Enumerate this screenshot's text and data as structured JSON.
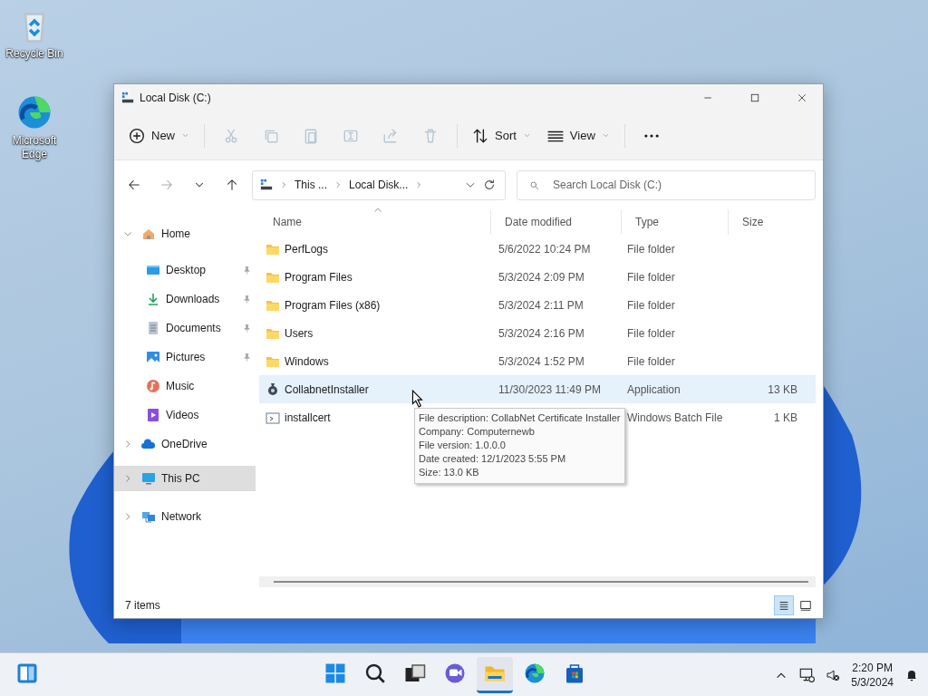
{
  "desktop_icons": [
    {
      "kind": "recycle",
      "label": "Recycle Bin"
    },
    {
      "kind": "edge",
      "label": "Microsoft Edge"
    }
  ],
  "window": {
    "title": "Local Disk (C:)"
  },
  "toolbar": [
    {
      "kind": "new",
      "label": "New",
      "disabled": false
    },
    {
      "kind": "cut",
      "disabled": true
    },
    {
      "kind": "copy",
      "disabled": true
    },
    {
      "kind": "paste",
      "disabled": true
    },
    {
      "kind": "rename",
      "disabled": true
    },
    {
      "kind": "share",
      "disabled": true
    },
    {
      "kind": "delete",
      "disabled": true
    },
    {
      "kind": "sort",
      "label": "Sort",
      "disabled": false
    },
    {
      "kind": "view",
      "label": "View",
      "disabled": false
    },
    {
      "kind": "more",
      "disabled": false
    }
  ],
  "nav": {
    "forward_disabled": true,
    "breadcrumb": [
      "This ...",
      "Local Disk..."
    ],
    "search": {
      "placeholder": "Search Local Disk (C:)"
    }
  },
  "sidebar": {
    "items": [
      {
        "kind": "home",
        "label": "Home",
        "expanded": true,
        "selected": false,
        "children": [
          {
            "kind": "desktop",
            "label": "Desktop",
            "pinned": true
          },
          {
            "kind": "downloads",
            "label": "Downloads",
            "pinned": true
          },
          {
            "kind": "documents",
            "label": "Documents",
            "pinned": true
          },
          {
            "kind": "pictures",
            "label": "Pictures",
            "pinned": true
          },
          {
            "kind": "music",
            "label": "Music",
            "pinned": false
          },
          {
            "kind": "videos",
            "label": "Videos",
            "pinned": false
          }
        ]
      },
      {
        "kind": "onedrive",
        "label": "OneDrive",
        "expanded": false,
        "selected": false
      },
      {
        "kind": "pc",
        "label": "This PC",
        "expanded": false,
        "selected": true
      },
      {
        "kind": "network",
        "label": "Network",
        "expanded": false,
        "selected": false
      }
    ]
  },
  "table": {
    "columns": [
      "Name",
      "Date modified",
      "Type",
      "Size"
    ],
    "rows": [
      {
        "kind": "folder",
        "name": "PerfLogs",
        "date": "5/6/2022 10:24 PM",
        "type": "File folder",
        "size": "",
        "selected": false
      },
      {
        "kind": "folder",
        "name": "Program Files",
        "date": "5/3/2024 2:09 PM",
        "type": "File folder",
        "size": "",
        "selected": false
      },
      {
        "kind": "folder",
        "name": "Program Files (x86)",
        "date": "5/3/2024 2:11 PM",
        "type": "File folder",
        "size": "",
        "selected": false
      },
      {
        "kind": "folder",
        "name": "Users",
        "date": "5/3/2024 2:16 PM",
        "type": "File folder",
        "size": "",
        "selected": false
      },
      {
        "kind": "folder",
        "name": "Windows",
        "date": "5/3/2024 1:52 PM",
        "type": "File folder",
        "size": "",
        "selected": false
      },
      {
        "kind": "app",
        "name": "CollabnetInstaller",
        "date": "11/30/2023 11:49 PM",
        "type": "Application",
        "size": "13 KB",
        "selected": true
      },
      {
        "kind": "batch",
        "name": "installcert",
        "date": "",
        "type": "Windows Batch File",
        "size": "1 KB",
        "selected": false
      }
    ]
  },
  "tooltip": [
    "File description: CollabNet Certificate Installer",
    "Company: Computernewb",
    "File version: 1.0.0.0",
    "Date created: 12/1/2023 5:55 PM",
    "Size: 13.0 KB"
  ],
  "status_bar": {
    "count": "7 items",
    "views": [
      {
        "kind": "details",
        "selected": true
      },
      {
        "kind": "tiles",
        "selected": false
      }
    ]
  },
  "taskbar": {
    "apps": [
      {
        "kind": "widgets",
        "active": false
      },
      {
        "kind": "start",
        "active": false
      },
      {
        "kind": "search",
        "active": false
      },
      {
        "kind": "taskview",
        "active": false
      },
      {
        "kind": "chat",
        "active": false
      },
      {
        "kind": "explorer",
        "active": true
      },
      {
        "kind": "edge",
        "active": false
      },
      {
        "kind": "store",
        "active": false
      }
    ],
    "time": "2:20 PM",
    "date": "5/3/2024"
  }
}
